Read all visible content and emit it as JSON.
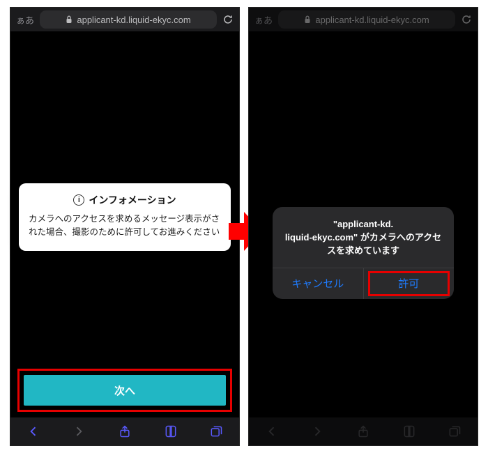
{
  "addressbar": {
    "aa": "ぁあ",
    "domain": "applicant-kd.liquid-ekyc.com"
  },
  "left": {
    "info": {
      "title": "インフォメーション",
      "body": "カメラへのアクセスを求めるメッセージ表示がされた場合、撮影のために許可してお進みください"
    },
    "next_label": "次へ"
  },
  "right": {
    "alert": {
      "message": "\"applicant-kd.\nliquid-ekyc.com\" がカメラへのアクセスを求めています",
      "cancel": "キャンセル",
      "allow": "許可"
    }
  },
  "colors": {
    "accent_button": "#21b7c4",
    "highlight": "#e60000",
    "ios_link": "#1f7cff"
  }
}
